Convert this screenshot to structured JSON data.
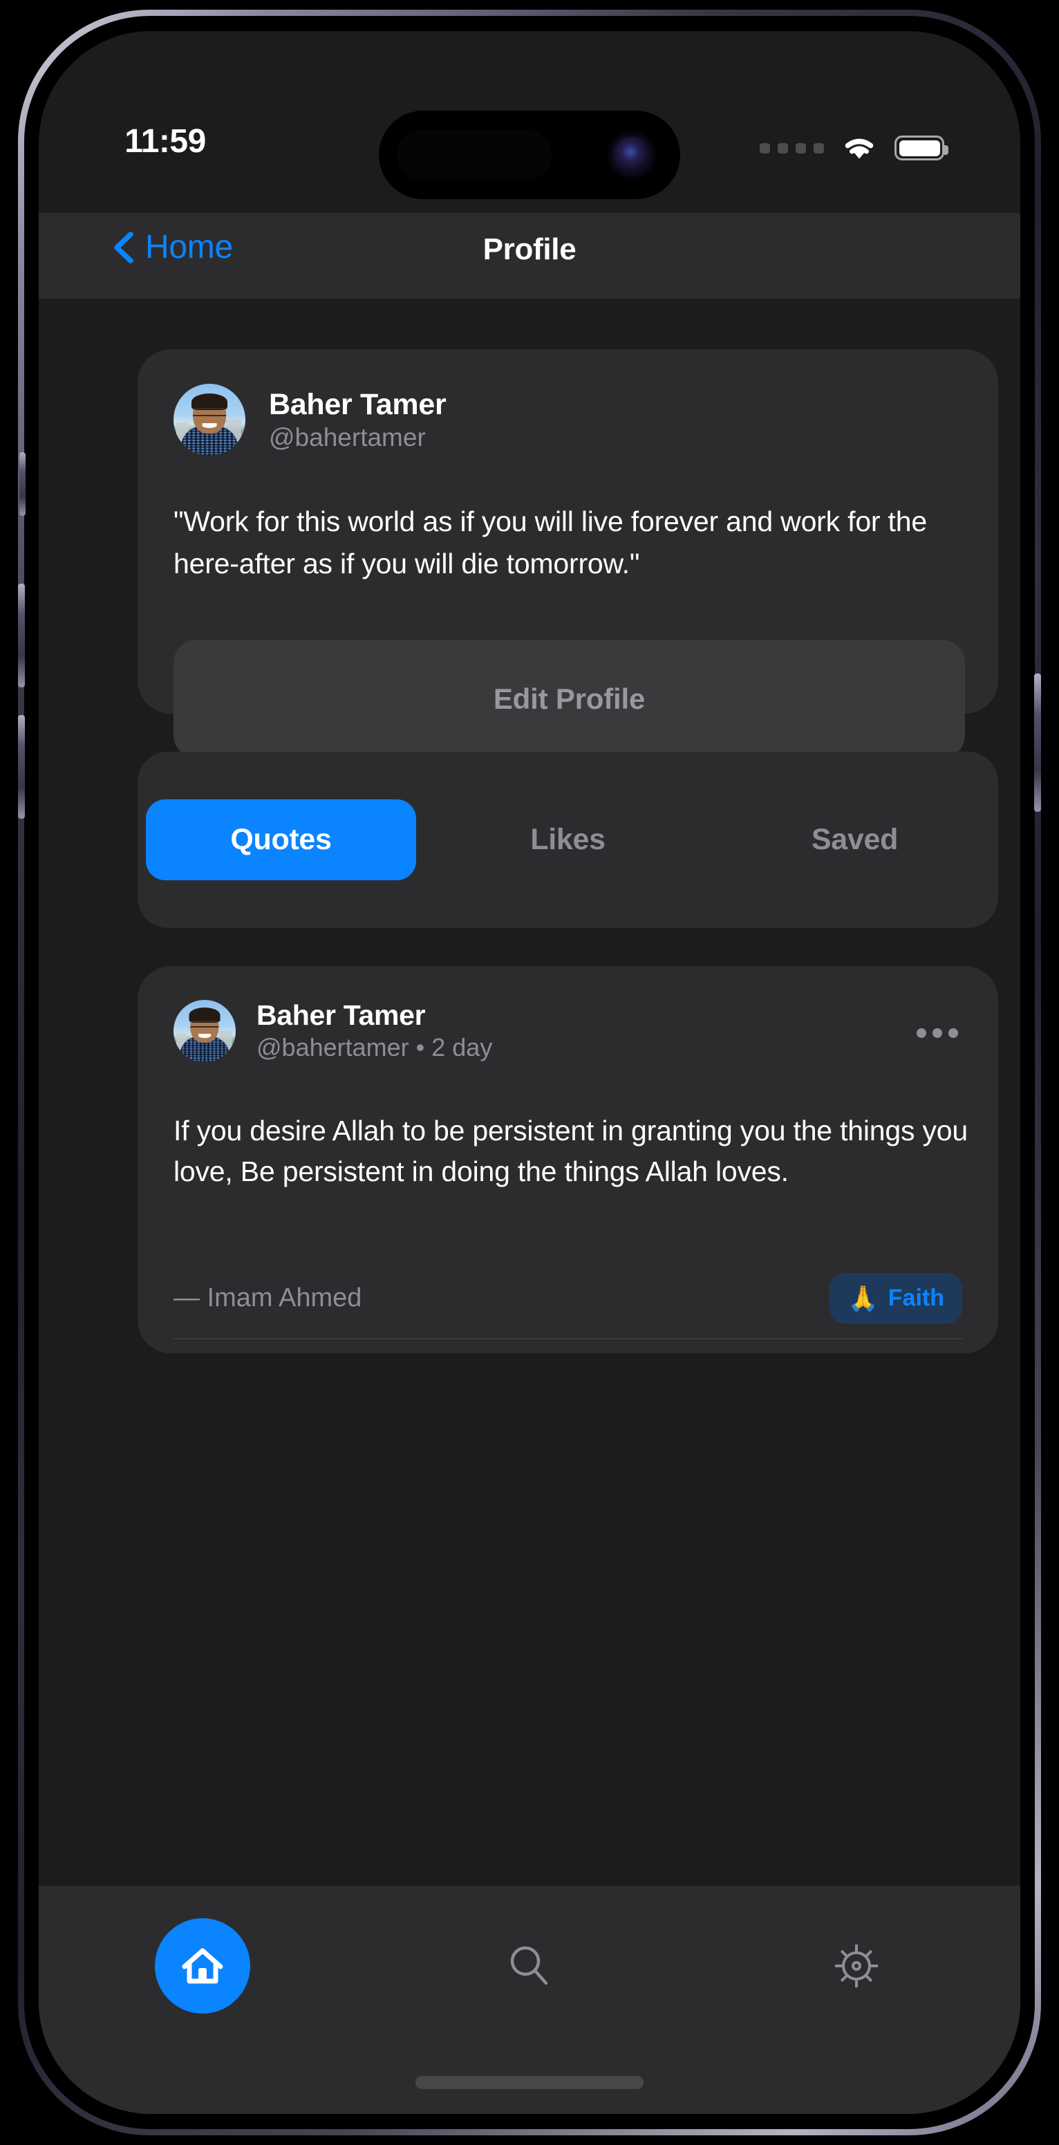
{
  "status_bar": {
    "time": "11:59",
    "signal_icon": "cellular-dots-icon",
    "wifi_icon": "wifi-icon",
    "battery_icon": "battery-full-icon"
  },
  "nav_bar": {
    "back_label": "Home",
    "back_icon": "chevron-left-icon",
    "title": "Profile"
  },
  "profile": {
    "avatar": "user-avatar-photo",
    "name": "Baher Tamer",
    "handle": "@bahertamer",
    "bio": "\"Work for this world as if you will live forever and work for the here-after as if you will die tomorrow.\"",
    "edit_button_label": "Edit Profile"
  },
  "tabs": [
    {
      "label": "Quotes",
      "active": true
    },
    {
      "label": "Likes",
      "active": false
    },
    {
      "label": "Saved",
      "active": false
    }
  ],
  "quote_card": {
    "avatar": "user-avatar-photo",
    "author_name": "Baher Tamer",
    "meta": "@bahertamer  •  2 day",
    "more_icon": "ellipsis-icon",
    "text": "If you desire Allah to be persistent in granting you the things you love, Be persistent in doing the things Allah loves.",
    "attribution": "— Imam Ahmed",
    "badge": {
      "icon": "praying-hands-icon",
      "emoji": "🙏",
      "label": "Faith"
    },
    "actions": [
      {
        "icon": "heart-icon",
        "label": ""
      },
      {
        "icon": "bookmark-icon",
        "label": ""
      }
    ]
  },
  "bottom_bar": {
    "items": [
      {
        "icon": "home-icon",
        "name": "home",
        "active": true
      },
      {
        "icon": "search-icon",
        "name": "search",
        "active": false
      },
      {
        "icon": "gear-icon",
        "name": "settings",
        "active": false
      }
    ]
  },
  "colors": {
    "accent_blue": "#0a84ff",
    "page_background": "#1c1c1e",
    "card_background": "#2c2c2e",
    "muted_text": "#8e8e93",
    "badge_background": "#1d3a5c"
  }
}
